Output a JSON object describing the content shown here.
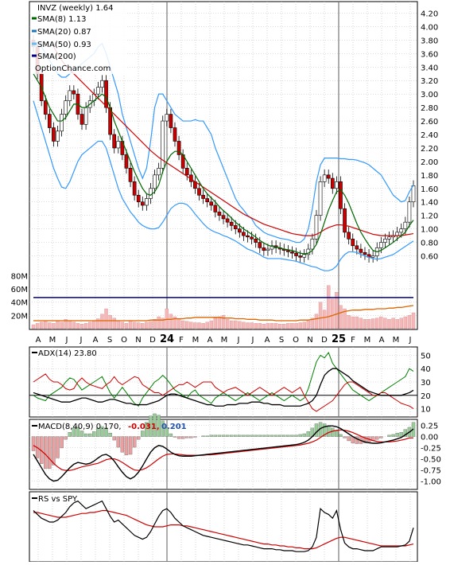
{
  "colors": {
    "price_candle_up": "#ffffff",
    "price_candle_down": "#cc0000",
    "sma8": "#006600",
    "sma20": "#1f77b4",
    "bollinger": "#3399ff",
    "sma50": "#cc0000",
    "sma200": "#000080",
    "volume": "#f4b8b8",
    "volume_avg": "#dd6600",
    "adx": "#000000",
    "plus_di": "#008000",
    "minus_di": "#cc0000",
    "macd": "#000000",
    "signal": "#cc0000",
    "hist_pos": "#99cc99",
    "hist_neg": "#e8a0a0",
    "grid": "#bbbbbb"
  },
  "legend": {
    "title": "INVZ (weekly) 1.64",
    "sma8": "SMA(8) 1.13",
    "sma20": "SMA(20) 0.87",
    "sma50": "SMA(50) 0.93",
    "sma200": "SMA(200)",
    "site": "OptionChance.com"
  },
  "indicators": {
    "adx_label": "ADX(14) 23.80",
    "macd_label": "MACD(8,40,9) 0.170,",
    "macd_val1": "-0.031,",
    "macd_val2": "0.201",
    "rs_label": "RS vs SPY"
  },
  "chart_data": [
    {
      "type": "line",
      "title": "INVZ (weekly) 1.64",
      "x_ticks": [
        "A",
        "M",
        "J",
        "J",
        "A",
        "S",
        "O",
        "N",
        "D",
        "24",
        "F",
        "M",
        "A",
        "M",
        "J",
        "J",
        "A",
        "S",
        "O",
        "N",
        "D",
        "25",
        "F",
        "M",
        "A",
        "M",
        "J"
      ],
      "y_ticks": [
        "4.20",
        "4.00",
        "3.80",
        "3.60",
        "3.40",
        "3.20",
        "3.00",
        "2.80",
        "2.60",
        "2.40",
        "2.20",
        "2.00",
        "1.80",
        "1.60",
        "1.40",
        "1.20",
        "1.00",
        "0.80",
        "0.60"
      ],
      "ylim": [
        0.5,
        4.3
      ],
      "close": [
        3.7,
        3.3,
        2.9,
        2.7,
        2.5,
        2.3,
        2.45,
        2.7,
        2.9,
        3.05,
        3.0,
        2.7,
        2.55,
        2.8,
        2.9,
        3.0,
        3.1,
        3.2,
        2.8,
        2.4,
        2.2,
        2.3,
        2.1,
        1.9,
        1.7,
        1.5,
        1.4,
        1.35,
        1.45,
        1.6,
        1.8,
        1.9,
        2.6,
        2.7,
        2.5,
        2.3,
        2.1,
        1.9,
        1.8,
        1.7,
        1.6,
        1.5,
        1.45,
        1.4,
        1.35,
        1.25,
        1.2,
        1.15,
        1.1,
        1.05,
        1.0,
        0.95,
        0.9,
        0.88,
        0.85,
        0.8,
        0.72,
        0.68,
        0.7,
        0.75,
        0.72,
        0.7,
        0.68,
        0.66,
        0.64,
        0.6,
        0.58,
        0.62,
        0.7,
        0.85,
        1.2,
        1.7,
        1.8,
        1.75,
        1.6,
        1.7,
        1.3,
        0.95,
        0.85,
        0.75,
        0.7,
        0.65,
        0.62,
        0.58,
        0.6,
        0.72,
        0.8,
        0.85,
        0.88,
        0.9,
        0.95,
        1.0,
        1.1,
        1.4,
        1.64
      ],
      "sma8": [
        3.3,
        3.2,
        3.1,
        2.95,
        2.8,
        2.7,
        2.6,
        2.6,
        2.65,
        2.75,
        2.85,
        2.85,
        2.8,
        2.8,
        2.85,
        2.9,
        2.95,
        3.0,
        2.95,
        2.8,
        2.6,
        2.45,
        2.3,
        2.15,
        2.0,
        1.85,
        1.72,
        1.6,
        1.52,
        1.5,
        1.55,
        1.65,
        1.85,
        2.0,
        2.1,
        2.15,
        2.15,
        2.1,
        2.0,
        1.9,
        1.8,
        1.7,
        1.6,
        1.52,
        1.46,
        1.4,
        1.33,
        1.27,
        1.22,
        1.16,
        1.1,
        1.05,
        1.0,
        0.96,
        0.92,
        0.88,
        0.83,
        0.79,
        0.76,
        0.74,
        0.73,
        0.72,
        0.7,
        0.69,
        0.68,
        0.66,
        0.64,
        0.63,
        0.64,
        0.68,
        0.77,
        0.92,
        1.1,
        1.28,
        1.42,
        1.55,
        1.58,
        1.5,
        1.38,
        1.23,
        1.08,
        0.95,
        0.85,
        0.76,
        0.68,
        0.66,
        0.68,
        0.72,
        0.76,
        0.8,
        0.85,
        0.9,
        0.95,
        1.05,
        1.13
      ],
      "sma50": [
        null,
        null,
        null,
        null,
        null,
        3.7,
        3.6,
        3.5,
        3.42,
        3.35,
        3.3,
        3.24,
        3.18,
        3.12,
        3.06,
        3.0,
        2.94,
        2.88,
        2.82,
        2.76,
        2.7,
        2.64,
        2.58,
        2.52,
        2.46,
        2.4,
        2.34,
        2.28,
        2.22,
        2.16,
        2.11,
        2.06,
        2.02,
        1.98,
        1.94,
        1.9,
        1.86,
        1.82,
        1.78,
        1.74,
        1.7,
        1.66,
        1.62,
        1.58,
        1.54,
        1.5,
        1.46,
        1.42,
        1.38,
        1.34,
        1.3,
        1.26,
        1.22,
        1.19,
        1.16,
        1.13,
        1.1,
        1.07,
        1.05,
        1.03,
        1.01,
        0.99,
        0.97,
        0.95,
        0.93,
        0.92,
        0.91,
        0.9,
        0.9,
        0.9,
        0.92,
        0.95,
        0.99,
        1.02,
        1.04,
        1.06,
        1.06,
        1.05,
        1.04,
        1.02,
        1.0,
        0.98,
        0.96,
        0.94,
        0.92,
        0.91,
        0.9,
        0.9,
        0.9,
        0.9,
        0.9,
        0.9,
        0.91,
        0.92,
        0.93
      ],
      "bb_upper": [
        3.7,
        3.75,
        3.7,
        3.6,
        3.5,
        3.4,
        3.3,
        3.25,
        3.25,
        3.3,
        3.35,
        3.4,
        3.45,
        3.5,
        3.55,
        3.6,
        3.7,
        3.75,
        3.6,
        3.4,
        3.2,
        3.0,
        2.7,
        2.5,
        2.3,
        2.1,
        1.9,
        1.75,
        1.9,
        2.3,
        2.8,
        3.0,
        3.0,
        2.9,
        2.8,
        2.7,
        2.65,
        2.6,
        2.6,
        2.6,
        2.62,
        2.6,
        2.6,
        2.5,
        2.4,
        2.2,
        2.05,
        1.9,
        1.75,
        1.6,
        1.45,
        1.35,
        1.28,
        1.2,
        1.15,
        1.05,
        1.0,
        0.95,
        0.92,
        0.9,
        0.88,
        0.86,
        0.85,
        0.84,
        0.82,
        0.8,
        0.8,
        0.85,
        1.0,
        1.3,
        1.7,
        1.95,
        2.05,
        2.05,
        2.05,
        2.05,
        2.04,
        2.04,
        2.03,
        2.03,
        2.02,
        2.0,
        1.98,
        1.95,
        1.9,
        1.85,
        1.8,
        1.7,
        1.6,
        1.5,
        1.45,
        1.4,
        1.42,
        1.55,
        1.65
      ],
      "bb_lower": [
        2.9,
        2.7,
        2.5,
        2.3,
        2.1,
        1.9,
        1.75,
        1.62,
        1.6,
        1.7,
        1.85,
        2.0,
        2.1,
        2.15,
        2.2,
        2.25,
        2.3,
        2.3,
        2.2,
        2.0,
        1.8,
        1.6,
        1.45,
        1.35,
        1.25,
        1.18,
        1.1,
        1.05,
        1.02,
        1.0,
        1.0,
        1.02,
        1.1,
        1.2,
        1.3,
        1.35,
        1.38,
        1.38,
        1.36,
        1.3,
        1.22,
        1.15,
        1.08,
        1.02,
        0.98,
        0.95,
        0.93,
        0.9,
        0.88,
        0.85,
        0.82,
        0.78,
        0.74,
        0.7,
        0.68,
        0.65,
        0.62,
        0.58,
        0.56,
        0.56,
        0.56,
        0.56,
        0.55,
        0.54,
        0.53,
        0.52,
        0.5,
        0.48,
        0.46,
        0.44,
        0.43,
        0.4,
        0.38,
        0.38,
        0.4,
        0.45,
        0.55,
        0.62,
        0.66,
        0.66,
        0.65,
        0.62,
        0.6,
        0.58,
        0.56,
        0.55,
        0.56,
        0.58,
        0.6,
        0.62,
        0.66,
        0.7,
        0.74,
        0.78,
        0.82
      ]
    },
    {
      "type": "bar",
      "title": "Volume",
      "y_ticks": [
        "80M",
        "60M",
        "40M",
        "20M"
      ],
      "ylim": [
        0,
        90
      ],
      "values": [
        6,
        8,
        10,
        12,
        9,
        8,
        12,
        10,
        14,
        12,
        10,
        8,
        7,
        8,
        10,
        12,
        15,
        22,
        30,
        20,
        16,
        12,
        10,
        8,
        12,
        10,
        9,
        8,
        10,
        11,
        14,
        18,
        16,
        30,
        22,
        18,
        14,
        12,
        11,
        10,
        9,
        9,
        8,
        10,
        12,
        16,
        18,
        20,
        14,
        12,
        12,
        11,
        10,
        9,
        9,
        8,
        8,
        7,
        8,
        8,
        8,
        7,
        7,
        8,
        8,
        8,
        9,
        10,
        12,
        16,
        22,
        40,
        28,
        65,
        45,
        55,
        35,
        30,
        20,
        18,
        18,
        16,
        14,
        14,
        15,
        16,
        18,
        16,
        14,
        16,
        14,
        16,
        18,
        20,
        24
      ],
      "avg": [
        12,
        12,
        12,
        12,
        12,
        12,
        12,
        12,
        12,
        12,
        12,
        12,
        12,
        12,
        12,
        12,
        12,
        12,
        12,
        12,
        12,
        12,
        12,
        12,
        12,
        12,
        12,
        12,
        12,
        13,
        13,
        13,
        13,
        14,
        14,
        15,
        15,
        15,
        16,
        16,
        17,
        17,
        17,
        17,
        17,
        17,
        17,
        16,
        16,
        16,
        15,
        15,
        15,
        14,
        14,
        14,
        13,
        13,
        13,
        13,
        12,
        12,
        12,
        12,
        12,
        12,
        13,
        13,
        13,
        14,
        15,
        16,
        17,
        18,
        20,
        22,
        24,
        26,
        27,
        28,
        28,
        28,
        29,
        29,
        29,
        30,
        30,
        30,
        31,
        31,
        32,
        32,
        33,
        34,
        35
      ],
      "sma200_level": 47
    },
    {
      "type": "line",
      "title": "ADX(14) 23.80",
      "y_ticks": [
        "50",
        "40",
        "30",
        "20",
        "10"
      ],
      "ylim": [
        5,
        55
      ],
      "adx": [
        22,
        21,
        20,
        19,
        18,
        17,
        16,
        15,
        15,
        15,
        16,
        17,
        18,
        18,
        17,
        16,
        15,
        15,
        16,
        17,
        17,
        16,
        15,
        14,
        14,
        13,
        13,
        13,
        13,
        14,
        15,
        16,
        18,
        20,
        21,
        21,
        20,
        19,
        18,
        17,
        16,
        15,
        14,
        13,
        13,
        12,
        12,
        12,
        13,
        13,
        13,
        14,
        14,
        14,
        15,
        15,
        15,
        14,
        14,
        13,
        13,
        13,
        12,
        12,
        12,
        12,
        12,
        13,
        14,
        16,
        20,
        28,
        35,
        38,
        40,
        40,
        38,
        36,
        34,
        31,
        29,
        27,
        25,
        23,
        22,
        21,
        20,
        20,
        20,
        20,
        20,
        20,
        21,
        22,
        23.8
      ],
      "plus_di": [
        20,
        18,
        17,
        16,
        20,
        22,
        24,
        26,
        30,
        33,
        32,
        28,
        24,
        26,
        28,
        30,
        32,
        34,
        28,
        22,
        18,
        22,
        26,
        22,
        18,
        14,
        12,
        18,
        22,
        26,
        30,
        32,
        35,
        32,
        28,
        24,
        22,
        20,
        18,
        22,
        24,
        20,
        18,
        16,
        14,
        18,
        20,
        22,
        20,
        18,
        16,
        18,
        20,
        22,
        20,
        18,
        16,
        18,
        20,
        22,
        20,
        18,
        16,
        18,
        20,
        18,
        16,
        18,
        25,
        35,
        45,
        50,
        48,
        52,
        44,
        40,
        36,
        32,
        28,
        24,
        22,
        20,
        18,
        16,
        18,
        20,
        22,
        24,
        26,
        28,
        30,
        32,
        34,
        40,
        38
      ],
      "minus_di": [
        30,
        32,
        34,
        36,
        32,
        30,
        30,
        28,
        25,
        24,
        25,
        30,
        33,
        30,
        28,
        27,
        26,
        25,
        28,
        30,
        34,
        30,
        28,
        30,
        32,
        34,
        33,
        28,
        26,
        24,
        22,
        22,
        20,
        22,
        24,
        26,
        28,
        28,
        30,
        28,
        26,
        28,
        30,
        30,
        30,
        26,
        24,
        22,
        24,
        25,
        26,
        24,
        22,
        20,
        22,
        24,
        26,
        24,
        22,
        20,
        22,
        24,
        26,
        24,
        22,
        24,
        26,
        20,
        15,
        10,
        8,
        10,
        12,
        14,
        16,
        20,
        24,
        28,
        30,
        30,
        28,
        26,
        24,
        22,
        20,
        20,
        22,
        22,
        20,
        18,
        16,
        14,
        13,
        12,
        10
      ]
    },
    {
      "type": "line",
      "title": "MACD(8,40,9) 0.170, -0.031, 0.201",
      "y_ticks": [
        "0.25",
        "0.00",
        "-0.25",
        "-0.50",
        "-0.75",
        "-1.00"
      ],
      "ylim": [
        -1.15,
        0.35
      ],
      "macd": [
        -0.4,
        -0.55,
        -0.7,
        -0.85,
        -0.95,
        -1.0,
        -0.98,
        -0.9,
        -0.8,
        -0.7,
        -0.62,
        -0.58,
        -0.6,
        -0.62,
        -0.6,
        -0.55,
        -0.48,
        -0.42,
        -0.4,
        -0.45,
        -0.55,
        -0.68,
        -0.8,
        -0.9,
        -0.95,
        -0.9,
        -0.8,
        -0.66,
        -0.5,
        -0.35,
        -0.25,
        -0.2,
        -0.22,
        -0.28,
        -0.35,
        -0.4,
        -0.43,
        -0.44,
        -0.44,
        -0.44,
        -0.43,
        -0.42,
        -0.41,
        -0.4,
        -0.39,
        -0.38,
        -0.37,
        -0.36,
        -0.35,
        -0.34,
        -0.33,
        -0.32,
        -0.31,
        -0.3,
        -0.29,
        -0.28,
        -0.27,
        -0.26,
        -0.25,
        -0.24,
        -0.23,
        -0.22,
        -0.21,
        -0.2,
        -0.19,
        -0.18,
        -0.16,
        -0.13,
        -0.08,
        0.0,
        0.1,
        0.18,
        0.22,
        0.24,
        0.24,
        0.22,
        0.18,
        0.12,
        0.06,
        0.0,
        -0.05,
        -0.09,
        -0.12,
        -0.14,
        -0.15,
        -0.15,
        -0.14,
        -0.12,
        -0.1,
        -0.08,
        -0.05,
        -0.02,
        0.04,
        0.1,
        0.17
      ],
      "signal": [
        -0.2,
        -0.25,
        -0.32,
        -0.4,
        -0.5,
        -0.6,
        -0.68,
        -0.74,
        -0.76,
        -0.76,
        -0.74,
        -0.71,
        -0.68,
        -0.66,
        -0.64,
        -0.62,
        -0.6,
        -0.56,
        -0.52,
        -0.5,
        -0.5,
        -0.53,
        -0.58,
        -0.64,
        -0.7,
        -0.75,
        -0.76,
        -0.74,
        -0.7,
        -0.64,
        -0.57,
        -0.5,
        -0.44,
        -0.4,
        -0.39,
        -0.39,
        -0.4,
        -0.41,
        -0.42,
        -0.42,
        -0.42,
        -0.42,
        -0.42,
        -0.41,
        -0.41,
        -0.4,
        -0.39,
        -0.38,
        -0.37,
        -0.36,
        -0.35,
        -0.34,
        -0.33,
        -0.32,
        -0.31,
        -0.3,
        -0.29,
        -0.28,
        -0.27,
        -0.26,
        -0.25,
        -0.24,
        -0.23,
        -0.22,
        -0.21,
        -0.2,
        -0.19,
        -0.17,
        -0.15,
        -0.12,
        -0.08,
        -0.02,
        0.04,
        0.09,
        0.12,
        0.14,
        0.15,
        0.14,
        0.12,
        0.09,
        0.05,
        0.01,
        -0.03,
        -0.06,
        -0.09,
        -0.11,
        -0.12,
        -0.12,
        -0.12,
        -0.11,
        -0.1,
        -0.08,
        -0.06,
        -0.03,
        -0.03
      ]
    },
    {
      "type": "line",
      "title": "RS vs SPY",
      "rs": [
        62,
        58,
        54,
        52,
        50,
        50,
        52,
        56,
        60,
        66,
        70,
        72,
        68,
        64,
        66,
        68,
        70,
        72,
        64,
        56,
        50,
        52,
        48,
        44,
        40,
        36,
        34,
        32,
        34,
        40,
        48,
        56,
        62,
        64,
        60,
        54,
        50,
        46,
        44,
        42,
        40,
        38,
        36,
        35,
        34,
        33,
        32,
        31,
        30,
        29,
        28,
        27,
        26,
        26,
        25,
        24,
        23,
        22,
        22,
        22,
        21,
        21,
        20,
        20,
        20,
        19,
        19,
        19,
        20,
        24,
        34,
        64,
        60,
        58,
        54,
        62,
        42,
        28,
        24,
        22,
        22,
        21,
        20,
        20,
        20,
        22,
        24,
        24,
        24,
        24,
        24,
        25,
        26,
        30,
        44
      ],
      "rs_avg": [
        60,
        60,
        59,
        58,
        57,
        56,
        55,
        55,
        55,
        56,
        57,
        58,
        59,
        59,
        60,
        60,
        61,
        62,
        62,
        61,
        60,
        59,
        58,
        57,
        55,
        53,
        51,
        49,
        47,
        46,
        45,
        45,
        45,
        46,
        47,
        47,
        47,
        46,
        46,
        45,
        44,
        43,
        42,
        41,
        40,
        39,
        38,
        37,
        36,
        35,
        34,
        33,
        32,
        31,
        30,
        29,
        28,
        27,
        27,
        26,
        26,
        25,
        25,
        24,
        24,
        23,
        23,
        22,
        22,
        22,
        23,
        25,
        27,
        29,
        31,
        33,
        34,
        34,
        33,
        32,
        31,
        30,
        29,
        28,
        27,
        26,
        25,
        25,
        25,
        25,
        25,
        25,
        25,
        26,
        27
      ]
    }
  ]
}
